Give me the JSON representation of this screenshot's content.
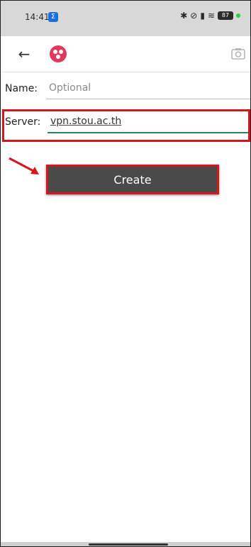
{
  "status_bar": {
    "time": "14:41",
    "app_badge": "Σ",
    "icons": [
      "bluetooth-icon",
      "mute-icon",
      "signal-icon",
      "wifi-icon"
    ],
    "battery": "87"
  },
  "app_bar": {
    "back_icon": "arrow-left-icon",
    "logo_icon": "app-logo-icon",
    "camera_icon": "camera-icon"
  },
  "form": {
    "name_label": "Name:",
    "name_placeholder": "Optional",
    "name_value": "",
    "server_label": "Server:",
    "server_value": "vpn.stou.ac.th"
  },
  "create_button": {
    "label": "Create"
  },
  "colors": {
    "highlight": "#d4161e",
    "button_bg": "#4a4a4a",
    "accent_underline": "#2f7f70",
    "logo": "#e0395b"
  }
}
